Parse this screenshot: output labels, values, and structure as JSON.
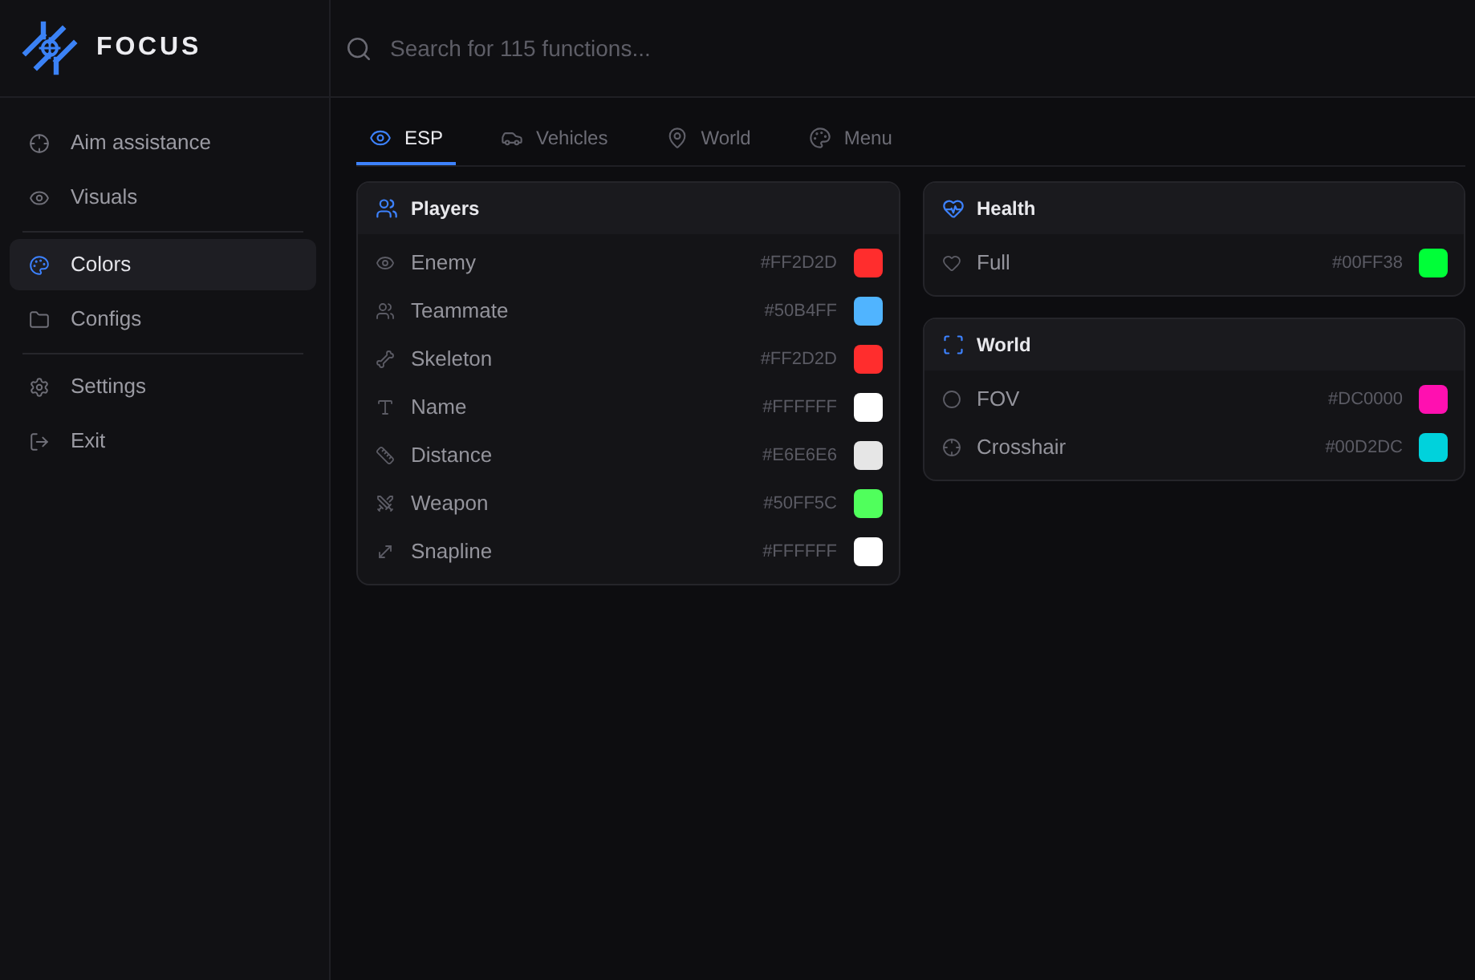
{
  "brand": {
    "name": "FOCUS"
  },
  "search": {
    "placeholder": "Search for 115 functions..."
  },
  "sidebar": {
    "sections": [
      {
        "items": [
          {
            "label": "Aim assistance",
            "selected": false
          },
          {
            "label": "Visuals",
            "selected": false
          }
        ]
      },
      {
        "items": [
          {
            "label": "Colors",
            "selected": true
          },
          {
            "label": "Configs",
            "selected": false
          }
        ]
      },
      {
        "items": [
          {
            "label": "Settings",
            "selected": false
          },
          {
            "label": "Exit",
            "selected": false
          }
        ]
      }
    ]
  },
  "tabs": [
    {
      "label": "ESP",
      "selected": true
    },
    {
      "label": "Vehicles",
      "selected": false
    },
    {
      "label": "World",
      "selected": false
    },
    {
      "label": "Menu",
      "selected": false
    }
  ],
  "columns": [
    {
      "cards": [
        {
          "title": "Players",
          "rows": [
            {
              "label": "Enemy",
              "hex": "#FF2D2D",
              "color": "#ff2d2d"
            },
            {
              "label": "Teammate",
              "hex": "#50B4FF",
              "color": "#50b4ff"
            },
            {
              "label": "Skeleton",
              "hex": "#FF2D2D",
              "color": "#ff2d2d"
            },
            {
              "label": "Name",
              "hex": "#FFFFFF",
              "color": "#ffffff"
            },
            {
              "label": "Distance",
              "hex": "#E6E6E6",
              "color": "#e6e6e6"
            },
            {
              "label": "Weapon",
              "hex": "#50FF5C",
              "color": "#50ff5c"
            },
            {
              "label": "Snapline",
              "hex": "#FFFFFF",
              "color": "#ffffff"
            }
          ]
        }
      ]
    },
    {
      "cards": [
        {
          "title": "Health",
          "rows": [
            {
              "label": "Full",
              "hex": "#00FF38",
              "color": "#00ff38"
            }
          ]
        },
        {
          "title": "World",
          "rows": [
            {
              "label": "FOV",
              "hex": "#DC0000",
              "color": "#ff10b0"
            },
            {
              "label": "Crosshair",
              "hex": "#00D2DC",
              "color": "#00d2dc"
            }
          ]
        }
      ]
    }
  ]
}
